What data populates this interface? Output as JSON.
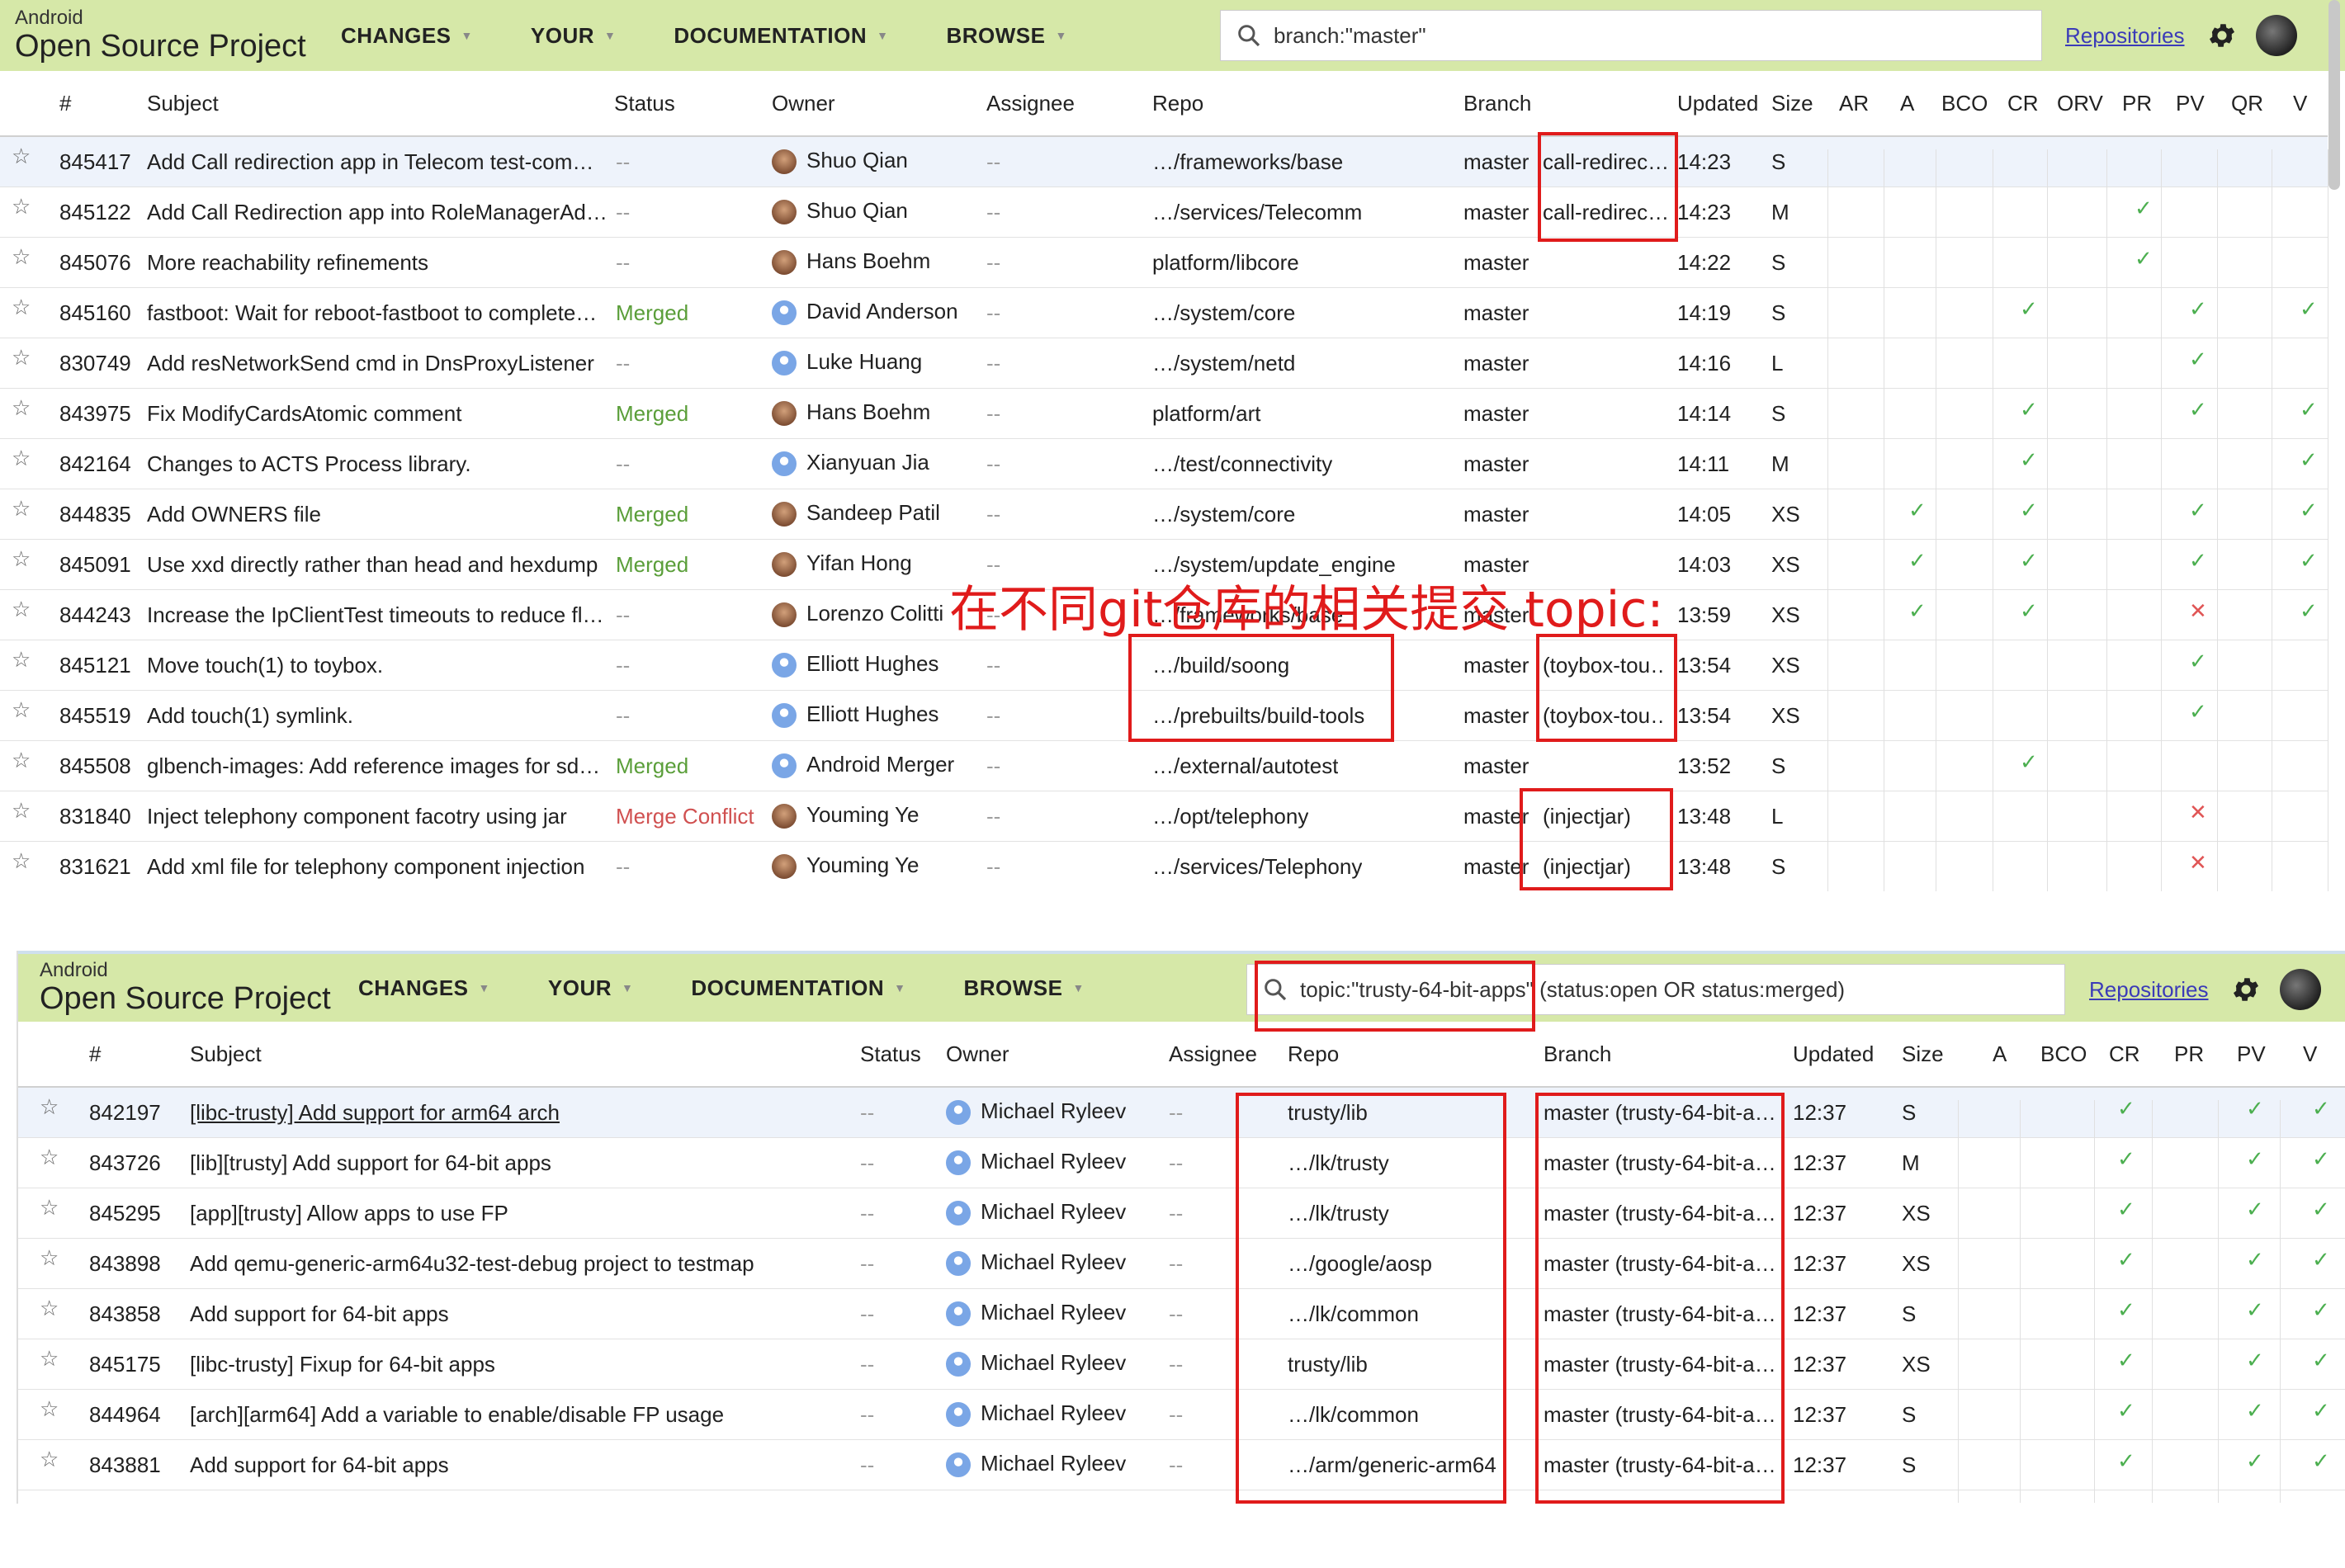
{
  "panel1": {
    "brand_small": "Android",
    "brand_big": "Open Source Project",
    "menu": [
      "CHANGES",
      "YOUR",
      "DOCUMENTATION",
      "BROWSE"
    ],
    "search_value": "branch:\"master\"",
    "repositories_link": "Repositories",
    "columns": [
      "#",
      "Subject",
      "Status",
      "Owner",
      "Assignee",
      "Repo",
      "Branch",
      "Updated",
      "Size",
      "AR",
      "A",
      "BCO",
      "CR",
      "ORV",
      "PR",
      "PV",
      "QR",
      "V"
    ],
    "rows": [
      {
        "num": "845417",
        "subject": "Add Call redirection app in Telecom test-com…",
        "status": "--",
        "owner": "Shuo Qian",
        "avatar": "photo",
        "assignee": "--",
        "repo": "…/frameworks/base",
        "branch": "master",
        "topic": "call-redirec…",
        "updated": "14:23",
        "size": "S",
        "votes": {}
      },
      {
        "num": "845122",
        "subject": "Add Call Redirection app into RoleManagerAd…",
        "status": "--",
        "owner": "Shuo Qian",
        "avatar": "photo",
        "assignee": "--",
        "repo": "…/services/Telecomm",
        "branch": "master",
        "topic": "call-redirec…",
        "updated": "14:23",
        "size": "M",
        "votes": {
          "PR": "check"
        }
      },
      {
        "num": "845076",
        "subject": "More reachability refinements",
        "status": "--",
        "owner": "Hans Boehm",
        "avatar": "photo",
        "assignee": "--",
        "repo": "platform/libcore",
        "branch": "master",
        "topic": "",
        "updated": "14:22",
        "size": "S",
        "votes": {
          "PR": "check"
        }
      },
      {
        "num": "845160",
        "subject": "fastboot: Wait for reboot-fastboot to complete…",
        "status": "Merged",
        "owner": "David Anderson",
        "avatar": "default",
        "assignee": "--",
        "repo": "…/system/core",
        "branch": "master",
        "topic": "",
        "updated": "14:19",
        "size": "S",
        "votes": {
          "CR": "check",
          "PV": "check",
          "V": "check"
        }
      },
      {
        "num": "830749",
        "subject": "Add resNetworkSend cmd in DnsProxyListener",
        "status": "--",
        "owner": "Luke Huang",
        "avatar": "default",
        "assignee": "--",
        "repo": "…/system/netd",
        "branch": "master",
        "topic": "",
        "updated": "14:16",
        "size": "L",
        "votes": {
          "PV": "check"
        }
      },
      {
        "num": "843975",
        "subject": "Fix ModifyCardsAtomic comment",
        "status": "Merged",
        "owner": "Hans Boehm",
        "avatar": "photo",
        "assignee": "--",
        "repo": "platform/art",
        "branch": "master",
        "topic": "",
        "updated": "14:14",
        "size": "S",
        "votes": {
          "CR": "check",
          "PV": "check",
          "V": "check"
        }
      },
      {
        "num": "842164",
        "subject": "Changes to ACTS Process library.",
        "status": "--",
        "owner": "Xianyuan Jia",
        "avatar": "default",
        "assignee": "--",
        "repo": "…/test/connectivity",
        "branch": "master",
        "topic": "",
        "updated": "14:11",
        "size": "M",
        "votes": {
          "CR": "check",
          "V": "check"
        }
      },
      {
        "num": "844835",
        "subject": "Add OWNERS file",
        "status": "Merged",
        "owner": "Sandeep Patil",
        "avatar": "photo",
        "assignee": "--",
        "repo": "…/system/core",
        "branch": "master",
        "topic": "",
        "updated": "14:05",
        "size": "XS",
        "votes": {
          "A": "check",
          "CR": "check",
          "PV": "check",
          "V": "check"
        }
      },
      {
        "num": "845091",
        "subject": "Use xxd directly rather than head and hexdump",
        "status": "Merged",
        "owner": "Yifan Hong",
        "avatar": "photo",
        "assignee": "--",
        "repo": "…/system/update_engine",
        "branch": "master",
        "topic": "",
        "updated": "14:03",
        "size": "XS",
        "votes": {
          "A": "check",
          "CR": "check",
          "PV": "check",
          "V": "check"
        }
      },
      {
        "num": "844243",
        "subject": "Increase the IpClientTest timeouts to reduce fl…",
        "status": "--",
        "owner": "Lorenzo Colitti",
        "avatar": "photo",
        "assignee": "--",
        "repo": "…/frameworks/base",
        "branch": "master",
        "topic": "",
        "updated": "13:59",
        "size": "XS",
        "votes": {
          "A": "check",
          "CR": "check",
          "PV": "cross",
          "V": "check"
        }
      },
      {
        "num": "845121",
        "subject": "Move touch(1) to toybox.",
        "status": "--",
        "owner": "Elliott Hughes",
        "avatar": "default",
        "assignee": "--",
        "repo": "…/build/soong",
        "branch": "master",
        "topic": "(toybox-tou…)",
        "updated": "13:54",
        "size": "XS",
        "votes": {
          "PV": "check"
        }
      },
      {
        "num": "845519",
        "subject": "Add touch(1) symlink.",
        "status": "--",
        "owner": "Elliott Hughes",
        "avatar": "default",
        "assignee": "--",
        "repo": "…/prebuilts/build-tools",
        "branch": "master",
        "topic": "(toybox-tou…)",
        "updated": "13:54",
        "size": "XS",
        "votes": {
          "PV": "check"
        }
      },
      {
        "num": "845508",
        "subject": "glbench-images: Add reference images for sd…",
        "status": "Merged",
        "owner": "Android Merger",
        "avatar": "default",
        "assignee": "--",
        "repo": "…/external/autotest",
        "branch": "master",
        "topic": "",
        "updated": "13:52",
        "size": "S",
        "votes": {
          "CR": "check"
        }
      },
      {
        "num": "831840",
        "subject": "Inject telephony component facotry using jar",
        "status": "Merge Conflict",
        "owner": "Youming Ye",
        "avatar": "photo",
        "assignee": "--",
        "repo": "…/opt/telephony",
        "branch": "master",
        "topic": "(injectjar)",
        "updated": "13:48",
        "size": "L",
        "votes": {
          "PV": "cross"
        }
      },
      {
        "num": "831621",
        "subject": "Add xml file for telephony component injection",
        "status": "--",
        "owner": "Youming Ye",
        "avatar": "photo",
        "assignee": "--",
        "repo": "…/services/Telephony",
        "branch": "master",
        "topic": "(injectjar)",
        "updated": "13:48",
        "size": "S",
        "votes": {
          "PV": "cross"
        }
      }
    ],
    "annotation": "在不同git仓库的相关提交  topic:"
  },
  "panel2": {
    "brand_small": "Android",
    "brand_big": "Open Source Project",
    "menu": [
      "CHANGES",
      "YOUR",
      "DOCUMENTATION",
      "BROWSE"
    ],
    "search_value": "topic:\"trusty-64-bit-apps\" (status:open OR status:merged)",
    "repositories_link": "Repositories",
    "columns": [
      "#",
      "Subject",
      "Status",
      "Owner",
      "Assignee",
      "Repo",
      "Branch",
      "Updated",
      "Size",
      "A",
      "BCO",
      "CR",
      "PR",
      "PV",
      "V"
    ],
    "rows": [
      {
        "num": "842197",
        "subject": "[libc-trusty] Add support for arm64 arch",
        "status": "--",
        "owner": "Michael Ryleev",
        "assignee": "--",
        "repo": "trusty/lib",
        "branch": "master (trusty-64-bit-a…",
        "updated": "12:37",
        "size": "S"
      },
      {
        "num": "843726",
        "subject": "[lib][trusty] Add support for 64-bit apps",
        "status": "--",
        "owner": "Michael Ryleev",
        "assignee": "--",
        "repo": "…/lk/trusty",
        "branch": "master (trusty-64-bit-a…",
        "updated": "12:37",
        "size": "M"
      },
      {
        "num": "845295",
        "subject": "[app][trusty] Allow apps to use FP",
        "status": "--",
        "owner": "Michael Ryleev",
        "assignee": "--",
        "repo": "…/lk/trusty",
        "branch": "master (trusty-64-bit-a…",
        "updated": "12:37",
        "size": "XS"
      },
      {
        "num": "843898",
        "subject": "Add qemu-generic-arm64u32-test-debug project to testmap",
        "status": "--",
        "owner": "Michael Ryleev",
        "assignee": "--",
        "repo": "…/google/aosp",
        "branch": "master (trusty-64-bit-a…",
        "updated": "12:37",
        "size": "XS"
      },
      {
        "num": "843858",
        "subject": "Add support for 64-bit apps",
        "status": "--",
        "owner": "Michael Ryleev",
        "assignee": "--",
        "repo": "…/lk/common",
        "branch": "master (trusty-64-bit-a…",
        "updated": "12:37",
        "size": "S"
      },
      {
        "num": "845175",
        "subject": "[libc-trusty] Fixup for 64-bit apps",
        "status": "--",
        "owner": "Michael Ryleev",
        "assignee": "--",
        "repo": "trusty/lib",
        "branch": "master (trusty-64-bit-a…",
        "updated": "12:37",
        "size": "XS"
      },
      {
        "num": "844964",
        "subject": "[arch][arm64] Add a variable to enable/disable FP usage",
        "status": "--",
        "owner": "Michael Ryleev",
        "assignee": "--",
        "repo": "…/lk/common",
        "branch": "master (trusty-64-bit-a…",
        "updated": "12:37",
        "size": "S"
      },
      {
        "num": "843881",
        "subject": "Add support for 64-bit apps",
        "status": "--",
        "owner": "Michael Ryleev",
        "assignee": "--",
        "repo": "…/arm/generic-arm64",
        "branch": "master (trusty-64-bit-a…",
        "updated": "12:37",
        "size": "S"
      }
    ]
  },
  "icons": {
    "star": "star-icon",
    "search": "search-icon",
    "gear": "gear-icon",
    "check": "check-icon",
    "cross": "cross-icon"
  },
  "colors": {
    "topbar": "#d6e8a8",
    "merged": "#5a9e39",
    "conflict": "#d05050",
    "check": "#4caf50",
    "cross": "#e05555",
    "annotation": "#e01b1b",
    "link": "#3b3bb8"
  }
}
